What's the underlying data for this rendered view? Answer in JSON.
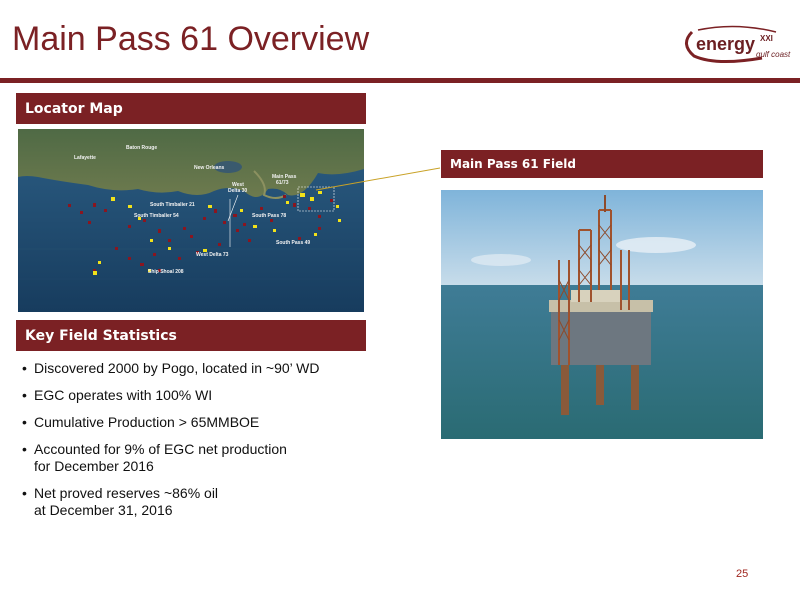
{
  "slide": {
    "title": "Main Pass 61 Overview",
    "page_number": "25",
    "accent_color": "#7b2124"
  },
  "logo": {
    "main": "energy",
    "superscript": "XXI",
    "sub": "gulf coast"
  },
  "locator_map": {
    "header": "Locator Map",
    "labels": {
      "baton_rouge": "Baton Rouge",
      "lafayette": "Lafayette",
      "new_orleans": "New Orleans",
      "main_pass": "Main Pass",
      "main_pass_num": "61/73",
      "west_delta_30_a": "West",
      "west_delta_30_b": "Delta 30",
      "south_timbalier_21": "South Timbalier 21",
      "south_timbalier_54": "South Timbalier 54",
      "south_pass_78": "South Pass 78",
      "south_pass_49": "South Pass 49",
      "west_delta_73": "West Delta 73",
      "ship_shoal_208": "Ship Shoal 208"
    }
  },
  "field_photo": {
    "header": "Main Pass 61 Field"
  },
  "key_stats": {
    "header": "Key Field Statistics",
    "bullets": [
      {
        "line1": "Discovered 2000 by Pogo, located in ~90’ WD",
        "line2": ""
      },
      {
        "line1": "EGC operates with 100% WI",
        "line2": ""
      },
      {
        "line1": "Cumulative Production > 65MMBOE",
        "line2": ""
      },
      {
        "line1": "Accounted for 9% of EGC net production",
        "line2": "for December 2016"
      },
      {
        "line1": "Net proved reserves ~86% oil",
        "line2": "at December 31, 2016"
      }
    ]
  }
}
